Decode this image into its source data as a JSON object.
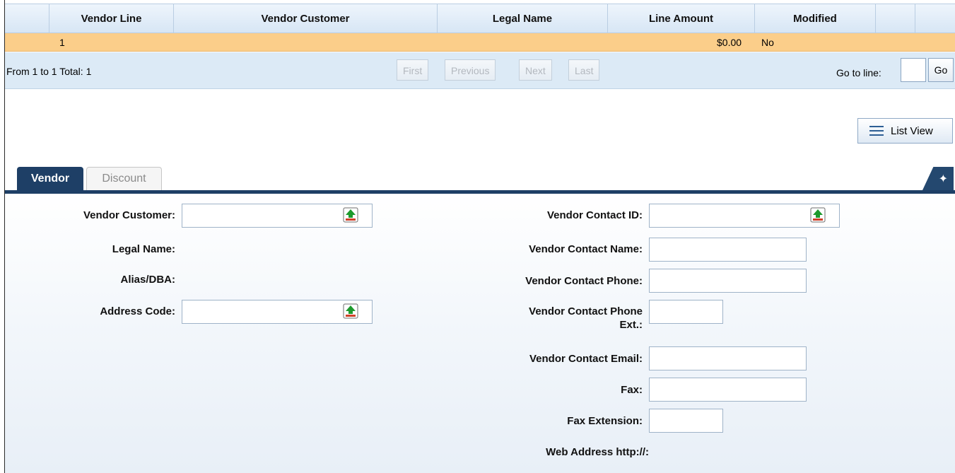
{
  "grid": {
    "columns": [
      "Vendor Line",
      "Vendor Customer",
      "Legal Name",
      "Line Amount",
      "Modified"
    ],
    "row": {
      "vendor_line": "1",
      "line_amount": "$0.00",
      "modified": "No"
    }
  },
  "pager": {
    "summary": "From 1 to 1 Total: 1",
    "first": "First",
    "previous": "Previous",
    "next": "Next",
    "last": "Last",
    "goto_label": "Go to line:",
    "goto_value": "",
    "go": "Go"
  },
  "list_view": {
    "label": "List View",
    "icon": "list-icon"
  },
  "tabs": [
    {
      "label": "Vendor",
      "active": true
    },
    {
      "label": "Discount",
      "active": false
    }
  ],
  "form": {
    "left": {
      "vendor_customer": "Vendor Customer:",
      "legal_name": "Legal Name:",
      "alias_dba": "Alias/DBA:",
      "address_code": "Address Code:"
    },
    "right": {
      "vendor_contact_id": "Vendor Contact ID:",
      "vendor_contact_name": "Vendor Contact Name:",
      "vendor_contact_phone": "Vendor Contact Phone:",
      "vendor_contact_phone_ext_1": "Vendor Contact Phone",
      "vendor_contact_phone_ext_2": "Ext.:",
      "vendor_contact_email": "Vendor Contact Email:",
      "fax": "Fax:",
      "fax_extension": "Fax Extension:",
      "web_address": "Web Address http://:"
    }
  },
  "colors": {
    "header_bg": "#d7e6f5",
    "selected_row": "#fbce8a",
    "tab_active": "#1e3f66",
    "lookup_green": "#1d9a2c",
    "lookup_red": "#d0412a"
  }
}
